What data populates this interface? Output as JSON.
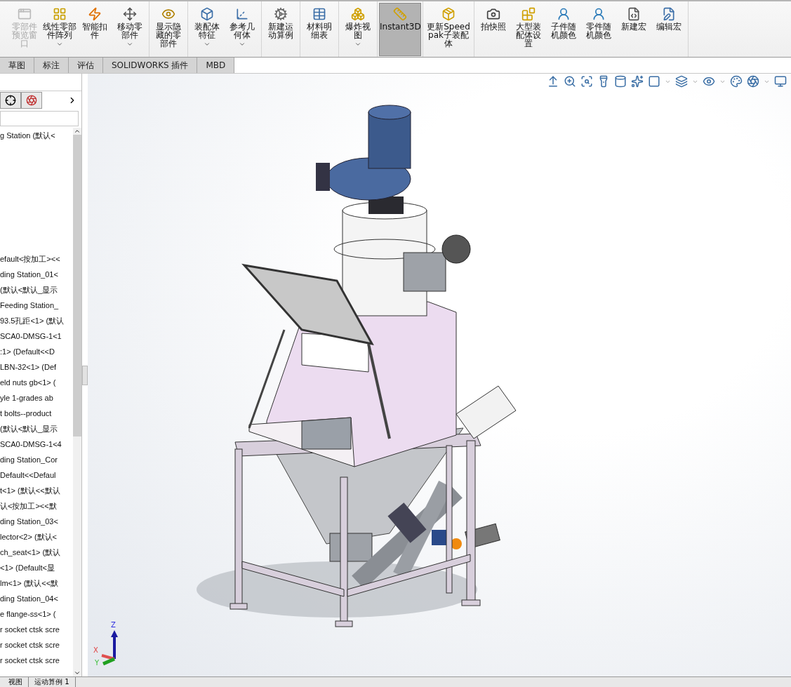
{
  "toolbar": {
    "groups": [
      {
        "items": [
          {
            "label": "零部件预览窗口",
            "disabled": true,
            "dropdown": false,
            "selected": false
          },
          {
            "label": "线性零部件阵列",
            "disabled": false,
            "dropdown": true,
            "selected": false
          },
          {
            "label": "智能扣件",
            "disabled": false,
            "dropdown": false,
            "selected": false
          },
          {
            "label": "移动零部件",
            "disabled": false,
            "dropdown": true,
            "selected": false
          }
        ]
      },
      {
        "items": [
          {
            "label": "显示隐藏的零部件",
            "disabled": false,
            "dropdown": false,
            "selected": false
          }
        ]
      },
      {
        "items": [
          {
            "label": "装配体特征",
            "disabled": false,
            "dropdown": true,
            "selected": false
          },
          {
            "label": "参考几何体",
            "disabled": false,
            "dropdown": true,
            "selected": false
          }
        ]
      },
      {
        "items": [
          {
            "label": "新建运动算例",
            "disabled": false,
            "dropdown": false,
            "selected": false
          }
        ]
      },
      {
        "items": [
          {
            "label": "材料明细表",
            "disabled": false,
            "dropdown": false,
            "selected": false
          }
        ]
      },
      {
        "items": [
          {
            "label": "爆炸视图",
            "disabled": false,
            "dropdown": true,
            "selected": false
          }
        ]
      },
      {
        "items": [
          {
            "label": "Instant3D",
            "disabled": false,
            "dropdown": false,
            "selected": true
          }
        ]
      },
      {
        "items": [
          {
            "label": "更新Speedpak子装配体",
            "disabled": false,
            "dropdown": false,
            "selected": false
          }
        ]
      },
      {
        "items": [
          {
            "label": "拍快照",
            "disabled": false,
            "dropdown": false,
            "selected": false
          },
          {
            "label": "大型装配体设置",
            "disabled": false,
            "dropdown": false,
            "selected": false
          },
          {
            "label": "子件随机颜色",
            "disabled": false,
            "dropdown": false,
            "selected": false
          },
          {
            "label": "零件随机颜色",
            "disabled": false,
            "dropdown": false,
            "selected": false
          },
          {
            "label": "新建宏",
            "disabled": false,
            "dropdown": false,
            "selected": false
          },
          {
            "label": "编辑宏",
            "disabled": false,
            "dropdown": false,
            "selected": false
          }
        ]
      }
    ]
  },
  "tabs": [
    {
      "label": "草图",
      "selected": false
    },
    {
      "label": "标注",
      "selected": false
    },
    {
      "label": "评估",
      "selected": false
    },
    {
      "label": "SOLIDWORKS 插件",
      "selected": false
    },
    {
      "label": "MBD",
      "selected": false
    }
  ],
  "tree": {
    "root": "g Station  (默认<",
    "items": [
      "efault<按加工><<",
      "ding Station_01<",
      "(默认<默认_显示",
      "Feeding Station_",
      "93.5孔距<1> (默认",
      "SCA0-DMSG-1<1",
      ":1> (Default<<D",
      "LBN-32<1> (Def",
      "eld nuts gb<1> (",
      "yle 1-grades ab",
      "t bolts--product",
      "(默认<默认_显示",
      "SCA0-DMSG-1<4",
      "ding Station_Cor",
      "Default<<Defaul",
      "t<1> (默认<<默认",
      "认<按加工><<默",
      "ding Station_03<",
      "lector<2> (默认<",
      "ch_seat<1> (默认",
      "<1> (Default<显",
      "lm<1> (默认<<默",
      "ding Station_04<",
      "e flange-ss<1> (",
      "r socket ctsk scre",
      "r socket ctsk scre",
      "r socket ctsk scre"
    ]
  },
  "triad": {
    "x": "X",
    "y": "Y",
    "z": "Z"
  },
  "bottom_tabs": [
    {
      "label": "视图",
      "selected": false
    },
    {
      "label": "运动算例 1",
      "selected": false
    }
  ]
}
